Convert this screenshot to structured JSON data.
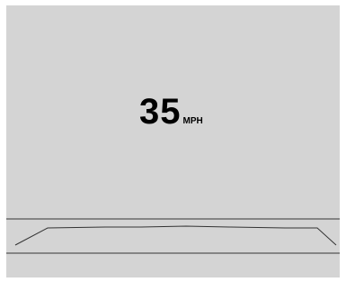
{
  "speedometer": {
    "value": "35",
    "unit": "MPH"
  },
  "colors": {
    "panel_background": "#d4d4d4",
    "text": "#000000",
    "road_lines": "#333333"
  }
}
